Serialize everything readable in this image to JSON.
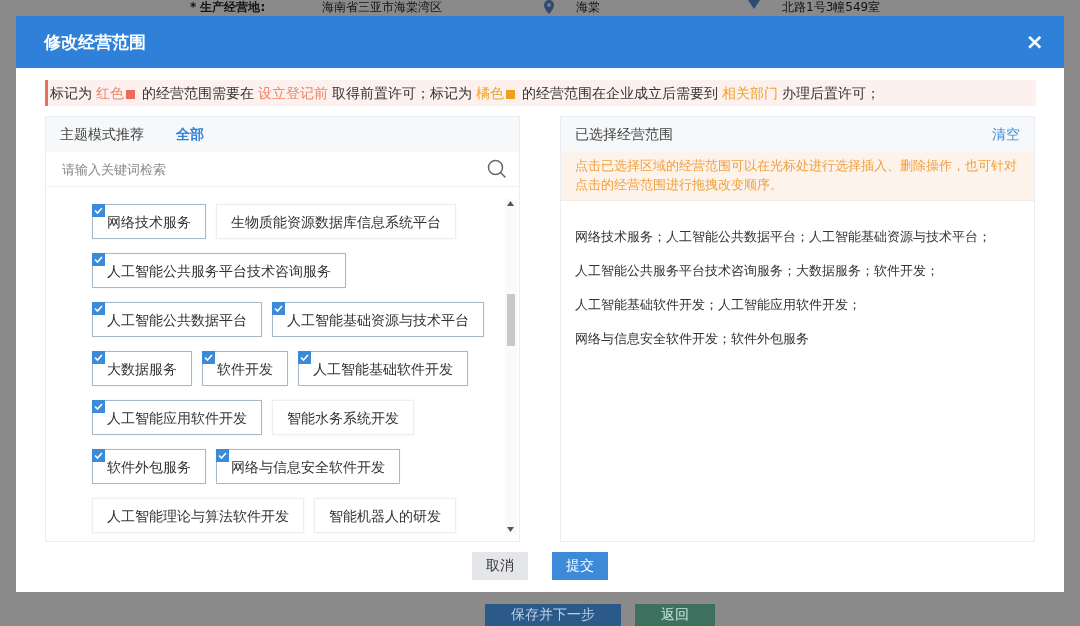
{
  "background_page": {
    "field_label": "* 生产经营地:",
    "address_region": "海南省三亚市海棠湾区",
    "address_town": "海棠",
    "address_detail": "北路1号3幢549室",
    "buttons": [
      {
        "label": "保存并下一步",
        "kind": "primary"
      },
      {
        "label": "返回",
        "kind": "secondary"
      }
    ]
  },
  "dialog": {
    "title": "修改经营范围",
    "close": "×",
    "notice": [
      {
        "kind": "text",
        "text": "标记为 "
      },
      {
        "kind": "highlight",
        "text": "红色",
        "color": "#f08468"
      },
      {
        "kind": "swatch",
        "color": "#ee6a5a"
      },
      {
        "kind": "text",
        "text": " 的经营范围需要在 "
      },
      {
        "kind": "highlight",
        "text": "设立登记前",
        "color": "#f08468"
      },
      {
        "kind": "text",
        "text": " 取得前置许可；标记为 "
      },
      {
        "kind": "highlight",
        "text": "橘色",
        "color": "#f0a428"
      },
      {
        "kind": "swatch",
        "color": "#f0a020"
      },
      {
        "kind": "text",
        "text": " 的经营范围在企业成立后需要到 "
      },
      {
        "kind": "highlight",
        "text": "相关部门",
        "color": "#f0a428"
      },
      {
        "kind": "text",
        "text": " 办理后置许可；"
      }
    ],
    "left_panel": {
      "tabs": [
        {
          "label": "主题模式推荐",
          "selected": false
        },
        {
          "label": "全部",
          "selected": true
        }
      ],
      "search": {
        "placeholder": "请输入关键词检索"
      },
      "rows": [
        [
          {
            "label": "网络技术服务",
            "checked": true
          },
          {
            "label": "生物质能资源数据库信息系统平台",
            "checked": false
          }
        ],
        [
          {
            "label": "人工智能公共服务平台技术咨询服务",
            "checked": true
          }
        ],
        [
          {
            "label": "人工智能公共数据平台",
            "checked": true
          },
          {
            "label": "人工智能基础资源与技术平台",
            "checked": true
          }
        ],
        [
          {
            "label": "大数据服务",
            "checked": true
          },
          {
            "label": "软件开发",
            "checked": true
          },
          {
            "label": "人工智能基础软件开发",
            "checked": true
          }
        ],
        [
          {
            "label": "人工智能应用软件开发",
            "checked": true
          },
          {
            "label": "智能水务系统开发",
            "checked": false
          }
        ],
        [
          {
            "label": "软件外包服务",
            "checked": true
          },
          {
            "label": "网络与信息安全软件开发",
            "checked": true
          }
        ],
        [
          {
            "label": "人工智能理论与算法软件开发",
            "checked": false
          },
          {
            "label": "智能机器人的研发",
            "checked": false
          }
        ]
      ]
    },
    "right_panel": {
      "title": "已选择经营范围",
      "clear": "清空",
      "hint": "点击已选择区域的经营范围可以在光标处进行选择插入、删除操作，也可针对点击的经营范围进行拖拽改变顺序。",
      "lines": [
        "网络技术服务；人工智能公共数据平台；人工智能基础资源与技术平台；",
        "人工智能公共服务平台技术咨询服务；大数据服务；软件开发；",
        "人工智能基础软件开发；人工智能应用软件开发；",
        "网络与信息安全软件开发；软件外包服务"
      ]
    },
    "buttons": [
      {
        "label": "取消",
        "kind": "secondary"
      },
      {
        "label": "提交",
        "kind": "primary"
      }
    ]
  }
}
